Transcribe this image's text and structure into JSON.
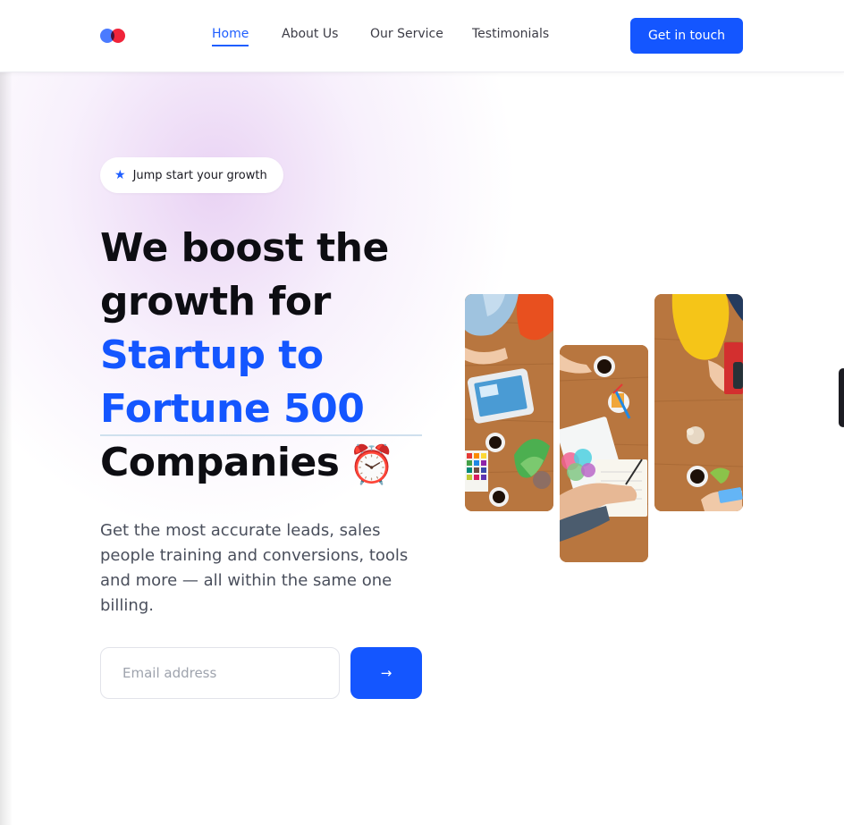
{
  "header": {
    "logo": "brand-logo",
    "nav": [
      {
        "label": "Home",
        "active": true
      },
      {
        "label": "About Us",
        "active": false
      },
      {
        "label": "Our Service",
        "active": false
      },
      {
        "label": "Testimonials",
        "active": false
      }
    ],
    "cta_label": "Get in touch"
  },
  "hero": {
    "badge_icon": "star-icon",
    "badge_text": "Jump start your growth",
    "headline": {
      "line1": "We boost the",
      "line2": "growth for",
      "accent1": "Startup to",
      "accent2": "Fortune 500",
      "line5": "Companies",
      "emoji": "⏰"
    },
    "subcopy": "Get the most accurate leads, sales people training and conversions, tools and more — all within the same one billing.",
    "email_placeholder": "Email address",
    "submit_label": "→"
  },
  "colors": {
    "accent": "#1456ff",
    "logo_blue": "#4b7bff",
    "logo_red": "#f0243a",
    "text_dark": "#0d0d12",
    "text_body": "#4a4f5c"
  }
}
